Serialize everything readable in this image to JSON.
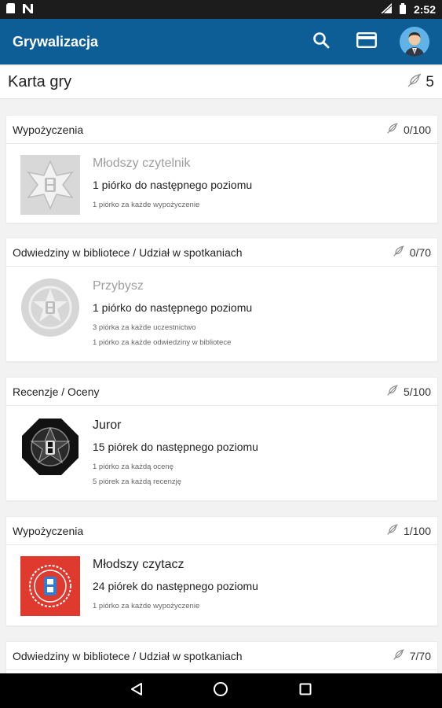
{
  "status_bar": {
    "time": "2:52",
    "icons": [
      "sd-card-icon",
      "n-icon",
      "signal-icon",
      "battery-icon"
    ]
  },
  "app_bar": {
    "title": "Grywalizacja",
    "icons": [
      "search-icon",
      "card-icon",
      "avatar"
    ]
  },
  "page": {
    "title": "Karta gry",
    "score": "5"
  },
  "cards": [
    {
      "category": "Wypożyczenia",
      "points": "0/100",
      "level": "Młodszy czytelnik",
      "level_dim": true,
      "next": "1 piórko do następnego poziomu",
      "rules": [
        "1 piórko za każde wypożyczenie"
      ]
    },
    {
      "category": "Odwiedziny w bibliotece / Udział w spotkaniach",
      "points": "0/70",
      "level": "Przybysz",
      "level_dim": true,
      "next": "1 piórko do następnego poziomu",
      "rules": [
        "3 piórka za każde uczestnictwo",
        "1 piórko za każde odwiedziny w bibliotece"
      ]
    },
    {
      "category": "Recenzje / Oceny",
      "points": "5/100",
      "level": "Juror",
      "level_dim": false,
      "next": "15 piórek do następnego poziomu",
      "rules": [
        "1 piórko za każdą ocenę",
        "5 piórek za każdą recenzję"
      ]
    },
    {
      "category": "Wypożyczenia",
      "points": "1/100",
      "level": "Młodszy czytacz",
      "level_dim": false,
      "next": "24 piórek do następnego poziomu",
      "rules": [
        "1 piórko za każde wypożyczenie"
      ]
    },
    {
      "category": "Odwiedziny w bibliotece / Udział w spotkaniach",
      "points": "7/70"
    }
  ],
  "colors": {
    "app_bar": "#0d5d97",
    "badge_red": "#e03a2f",
    "badge_dark": "#111111"
  }
}
